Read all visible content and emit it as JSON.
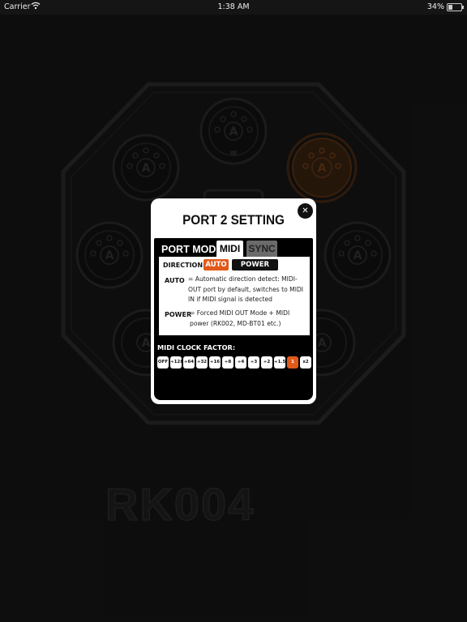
{
  "status_bar": {
    "carrier": "Carrier",
    "time": "1:38 AM",
    "battery": "34%"
  },
  "device": {
    "brand": "RK004",
    "port_label": "A"
  },
  "modal": {
    "title": "PORT 2 SETTING",
    "close_icon": "close-icon",
    "port_mode_label": "PORT MODE:",
    "tabs": [
      "MIDI",
      "SYNC"
    ],
    "selected_tab": "MIDI",
    "direction_label": "DIRECTION:",
    "direction_options": [
      "AUTO",
      "POWER OUT"
    ],
    "selected_direction": "AUTO",
    "descriptions": [
      {
        "key": "AUTO",
        "text": "= Automatic direction detect: MIDI-OUT port by default, switches to MIDI IN if MIDI signal is detected"
      },
      {
        "key": "POWER",
        "text": "= Forced MIDI OUT Mode + MIDI power (RK002, MD-BT01 etc.)"
      }
    ],
    "clock_factor_label": "MIDI CLOCK FACTOR:",
    "clock_factors": [
      "OFF",
      "÷128",
      "÷64",
      "÷32",
      "÷16",
      "÷8",
      "÷4",
      "÷3",
      "÷2",
      "÷1.5",
      "1",
      "x2"
    ],
    "selected_clock_factor": "1"
  },
  "colors": {
    "accent": "#e15a1a",
    "background": "#151515"
  }
}
